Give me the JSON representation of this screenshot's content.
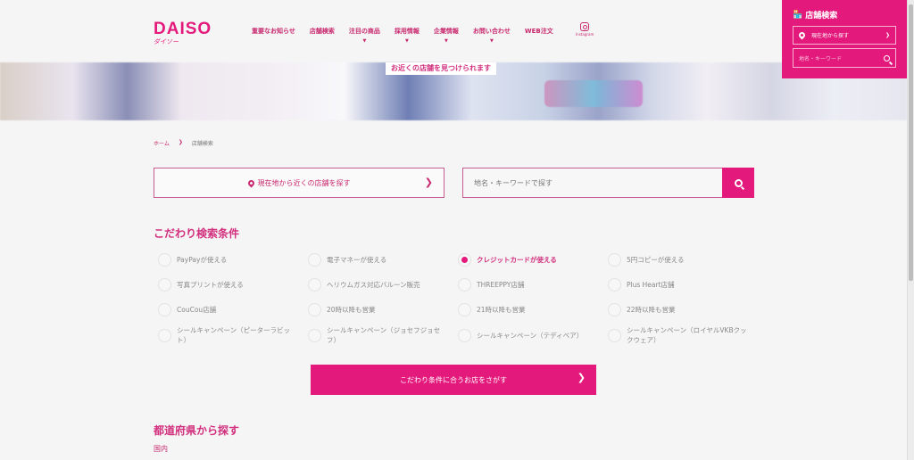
{
  "header": {
    "logo_en": "DAISO",
    "logo_ja": "ダイソー",
    "nav": [
      {
        "label": "重要なお知らせ",
        "has_dropdown": false
      },
      {
        "label": "店舗検索",
        "has_dropdown": false
      },
      {
        "label": "注目の商品",
        "has_dropdown": true
      },
      {
        "label": "採用情報",
        "has_dropdown": true
      },
      {
        "label": "企業情報",
        "has_dropdown": true
      },
      {
        "label": "お問い合わせ",
        "has_dropdown": true
      },
      {
        "label": "WEB注文",
        "has_dropdown": false
      }
    ],
    "instagram_label": "Instagram",
    "dropdown_caret": "▼"
  },
  "hero": {
    "label": "お近くの店舗を見つけられます"
  },
  "side_panel": {
    "title": "店舗検索",
    "location_button": "現在地から探す",
    "keyword_placeholder": "地名・キーワード",
    "chevron": "❯"
  },
  "breadcrumb": {
    "home": "ホーム",
    "separator": "❯",
    "current": "店舗検索"
  },
  "search": {
    "location_button": "現在地から近くの店舗を探す",
    "chevron": "❯",
    "keyword_placeholder": "地名・キーワードで探す"
  },
  "conditions": {
    "title": "こだわり検索条件",
    "items": [
      {
        "label": "PayPayが使える",
        "checked": false
      },
      {
        "label": "電子マネーが使える",
        "checked": false
      },
      {
        "label": "クレジットカードが使える",
        "checked": true
      },
      {
        "label": "5円コピーが使える",
        "checked": false
      },
      {
        "label": "写真プリントが使える",
        "checked": false
      },
      {
        "label": "ヘリウムガス対応バルーン販売",
        "checked": false
      },
      {
        "label": "THREEPPY店舗",
        "checked": false
      },
      {
        "label": "Plus Heart店舗",
        "checked": false
      },
      {
        "label": "CouCou店舗",
        "checked": false
      },
      {
        "label": "20時以降も営業",
        "checked": false
      },
      {
        "label": "21時以降も営業",
        "checked": false
      },
      {
        "label": "22時以降も営業",
        "checked": false
      },
      {
        "label": "シールキャンペーン（ピーターラビット）",
        "checked": false
      },
      {
        "label": "シールキャンペーン（ジョセフジョセフ）",
        "checked": false
      },
      {
        "label": "シールキャンペーン（テディベア）",
        "checked": false
      },
      {
        "label": "シールキャンペーン（ロイヤルVKBクックウェア）",
        "checked": false
      }
    ],
    "submit": "こだわり条件に合うお店をさがす",
    "submit_chevron": "❯"
  },
  "prefecture": {
    "title": "都道府県から探す",
    "domestic": "国内"
  },
  "colors": {
    "brand": "#e4197c",
    "text_accent": "#d2307e",
    "background": "#f5f5f5"
  }
}
